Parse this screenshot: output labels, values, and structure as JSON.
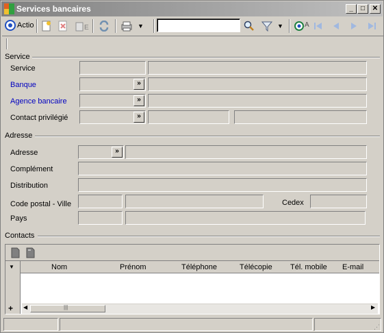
{
  "window": {
    "title": "Services bancaires"
  },
  "toolbar": {
    "action_label": "Actio",
    "search_value": "",
    "refresh_label": "A"
  },
  "sections": {
    "service": {
      "title": "Service",
      "service_label": "Service",
      "banque_label": "Banque",
      "agence_label": "Agence bancaire",
      "contact_label": "Contact privilégié"
    },
    "adresse": {
      "title": "Adresse",
      "adresse_label": "Adresse",
      "complement_label": "Complément",
      "distribution_label": "Distribution",
      "cp_ville_label": "Code postal - Ville",
      "cedex_label": "Cedex",
      "pays_label": "Pays"
    },
    "contacts": {
      "title": "Contacts",
      "columns": [
        "Nom",
        "Prénom",
        "Téléphone",
        "Télécopie",
        "Tél. mobile",
        "E-mail"
      ],
      "add_row_label": "+"
    }
  },
  "colors": {
    "link_label": "#0000c0",
    "titlebar_start": "#808080",
    "titlebar_end": "#c0c0c0"
  }
}
